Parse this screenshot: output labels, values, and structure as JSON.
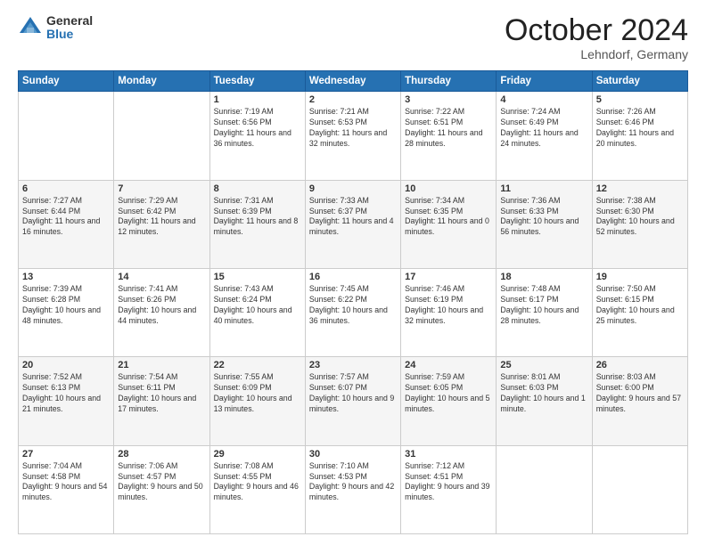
{
  "logo": {
    "general": "General",
    "blue": "Blue"
  },
  "header": {
    "month": "October 2024",
    "location": "Lehndorf, Germany"
  },
  "weekdays": [
    "Sunday",
    "Monday",
    "Tuesday",
    "Wednesday",
    "Thursday",
    "Friday",
    "Saturday"
  ],
  "weeks": [
    [
      {
        "day": "",
        "sunrise": "",
        "sunset": "",
        "daylight": ""
      },
      {
        "day": "",
        "sunrise": "",
        "sunset": "",
        "daylight": ""
      },
      {
        "day": "1",
        "sunrise": "Sunrise: 7:19 AM",
        "sunset": "Sunset: 6:56 PM",
        "daylight": "Daylight: 11 hours and 36 minutes."
      },
      {
        "day": "2",
        "sunrise": "Sunrise: 7:21 AM",
        "sunset": "Sunset: 6:53 PM",
        "daylight": "Daylight: 11 hours and 32 minutes."
      },
      {
        "day": "3",
        "sunrise": "Sunrise: 7:22 AM",
        "sunset": "Sunset: 6:51 PM",
        "daylight": "Daylight: 11 hours and 28 minutes."
      },
      {
        "day": "4",
        "sunrise": "Sunrise: 7:24 AM",
        "sunset": "Sunset: 6:49 PM",
        "daylight": "Daylight: 11 hours and 24 minutes."
      },
      {
        "day": "5",
        "sunrise": "Sunrise: 7:26 AM",
        "sunset": "Sunset: 6:46 PM",
        "daylight": "Daylight: 11 hours and 20 minutes."
      }
    ],
    [
      {
        "day": "6",
        "sunrise": "Sunrise: 7:27 AM",
        "sunset": "Sunset: 6:44 PM",
        "daylight": "Daylight: 11 hours and 16 minutes."
      },
      {
        "day": "7",
        "sunrise": "Sunrise: 7:29 AM",
        "sunset": "Sunset: 6:42 PM",
        "daylight": "Daylight: 11 hours and 12 minutes."
      },
      {
        "day": "8",
        "sunrise": "Sunrise: 7:31 AM",
        "sunset": "Sunset: 6:39 PM",
        "daylight": "Daylight: 11 hours and 8 minutes."
      },
      {
        "day": "9",
        "sunrise": "Sunrise: 7:33 AM",
        "sunset": "Sunset: 6:37 PM",
        "daylight": "Daylight: 11 hours and 4 minutes."
      },
      {
        "day": "10",
        "sunrise": "Sunrise: 7:34 AM",
        "sunset": "Sunset: 6:35 PM",
        "daylight": "Daylight: 11 hours and 0 minutes."
      },
      {
        "day": "11",
        "sunrise": "Sunrise: 7:36 AM",
        "sunset": "Sunset: 6:33 PM",
        "daylight": "Daylight: 10 hours and 56 minutes."
      },
      {
        "day": "12",
        "sunrise": "Sunrise: 7:38 AM",
        "sunset": "Sunset: 6:30 PM",
        "daylight": "Daylight: 10 hours and 52 minutes."
      }
    ],
    [
      {
        "day": "13",
        "sunrise": "Sunrise: 7:39 AM",
        "sunset": "Sunset: 6:28 PM",
        "daylight": "Daylight: 10 hours and 48 minutes."
      },
      {
        "day": "14",
        "sunrise": "Sunrise: 7:41 AM",
        "sunset": "Sunset: 6:26 PM",
        "daylight": "Daylight: 10 hours and 44 minutes."
      },
      {
        "day": "15",
        "sunrise": "Sunrise: 7:43 AM",
        "sunset": "Sunset: 6:24 PM",
        "daylight": "Daylight: 10 hours and 40 minutes."
      },
      {
        "day": "16",
        "sunrise": "Sunrise: 7:45 AM",
        "sunset": "Sunset: 6:22 PM",
        "daylight": "Daylight: 10 hours and 36 minutes."
      },
      {
        "day": "17",
        "sunrise": "Sunrise: 7:46 AM",
        "sunset": "Sunset: 6:19 PM",
        "daylight": "Daylight: 10 hours and 32 minutes."
      },
      {
        "day": "18",
        "sunrise": "Sunrise: 7:48 AM",
        "sunset": "Sunset: 6:17 PM",
        "daylight": "Daylight: 10 hours and 28 minutes."
      },
      {
        "day": "19",
        "sunrise": "Sunrise: 7:50 AM",
        "sunset": "Sunset: 6:15 PM",
        "daylight": "Daylight: 10 hours and 25 minutes."
      }
    ],
    [
      {
        "day": "20",
        "sunrise": "Sunrise: 7:52 AM",
        "sunset": "Sunset: 6:13 PM",
        "daylight": "Daylight: 10 hours and 21 minutes."
      },
      {
        "day": "21",
        "sunrise": "Sunrise: 7:54 AM",
        "sunset": "Sunset: 6:11 PM",
        "daylight": "Daylight: 10 hours and 17 minutes."
      },
      {
        "day": "22",
        "sunrise": "Sunrise: 7:55 AM",
        "sunset": "Sunset: 6:09 PM",
        "daylight": "Daylight: 10 hours and 13 minutes."
      },
      {
        "day": "23",
        "sunrise": "Sunrise: 7:57 AM",
        "sunset": "Sunset: 6:07 PM",
        "daylight": "Daylight: 10 hours and 9 minutes."
      },
      {
        "day": "24",
        "sunrise": "Sunrise: 7:59 AM",
        "sunset": "Sunset: 6:05 PM",
        "daylight": "Daylight: 10 hours and 5 minutes."
      },
      {
        "day": "25",
        "sunrise": "Sunrise: 8:01 AM",
        "sunset": "Sunset: 6:03 PM",
        "daylight": "Daylight: 10 hours and 1 minute."
      },
      {
        "day": "26",
        "sunrise": "Sunrise: 8:03 AM",
        "sunset": "Sunset: 6:00 PM",
        "daylight": "Daylight: 9 hours and 57 minutes."
      }
    ],
    [
      {
        "day": "27",
        "sunrise": "Sunrise: 7:04 AM",
        "sunset": "Sunset: 4:58 PM",
        "daylight": "Daylight: 9 hours and 54 minutes."
      },
      {
        "day": "28",
        "sunrise": "Sunrise: 7:06 AM",
        "sunset": "Sunset: 4:57 PM",
        "daylight": "Daylight: 9 hours and 50 minutes."
      },
      {
        "day": "29",
        "sunrise": "Sunrise: 7:08 AM",
        "sunset": "Sunset: 4:55 PM",
        "daylight": "Daylight: 9 hours and 46 minutes."
      },
      {
        "day": "30",
        "sunrise": "Sunrise: 7:10 AM",
        "sunset": "Sunset: 4:53 PM",
        "daylight": "Daylight: 9 hours and 42 minutes."
      },
      {
        "day": "31",
        "sunrise": "Sunrise: 7:12 AM",
        "sunset": "Sunset: 4:51 PM",
        "daylight": "Daylight: 9 hours and 39 minutes."
      },
      {
        "day": "",
        "sunrise": "",
        "sunset": "",
        "daylight": ""
      },
      {
        "day": "",
        "sunrise": "",
        "sunset": "",
        "daylight": ""
      }
    ]
  ]
}
